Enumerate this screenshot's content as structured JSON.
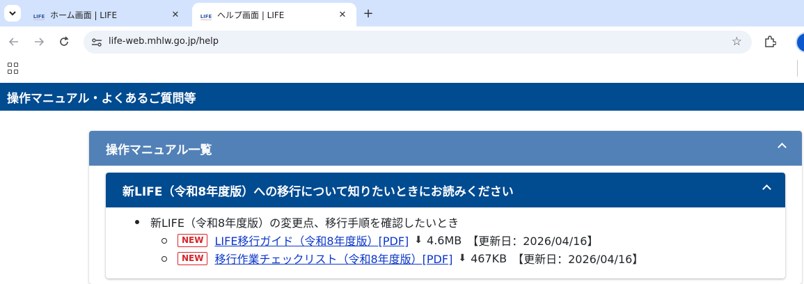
{
  "browser": {
    "tabs": [
      {
        "title": "ホーム画面 | LIFE",
        "favicon_text": "LIFE",
        "close": "✕"
      },
      {
        "title": "ヘルプ画面 | LIFE",
        "favicon_text": "LIFE",
        "close": "✕"
      }
    ],
    "newtab": "+",
    "url": "life-web.mhlw.go.jp/help"
  },
  "page": {
    "header_title": "操作マニュアル・よくあるご質問等",
    "section_title": "操作マニュアル一覧",
    "subsection_title": "新LIFE（令和8年度版）への移行について知りたいときにお読みください",
    "item_text": "新LIFE（令和8年度版）の変更点、移行手順を確認したいとき",
    "docs": [
      {
        "badge": "NEW",
        "link": "LIFE移行ガイド（令和8年度版）[PDF]",
        "size": "4.6MB",
        "updated": "【更新日：2026/04/16】"
      },
      {
        "badge": "NEW",
        "link": "移行作業チェックリスト（令和8年度版）[PDF]",
        "size": "467KB",
        "updated": "【更新日：2026/04/16】"
      }
    ]
  },
  "colors": {
    "header_bg": "#014b91",
    "section_bg": "#5281b7",
    "badge": "#d7242a",
    "link": "#0a36c9"
  },
  "icons": [
    "tab-list-icon",
    "back-icon",
    "forward-icon",
    "reload-icon",
    "site-settings-icon",
    "star-icon",
    "extensions-icon",
    "apps-icon",
    "chevron-up-icon",
    "download-icon"
  ]
}
